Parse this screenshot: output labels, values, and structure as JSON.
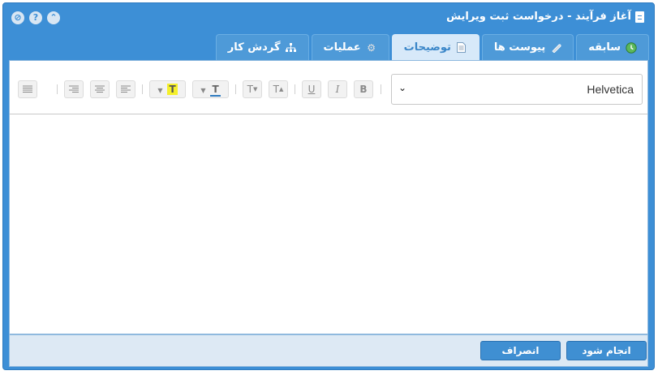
{
  "window": {
    "title": "آغاز فرآیند - درخواست ثبت ویرایش",
    "controls": [
      "collapse",
      "help",
      "close"
    ]
  },
  "tabs": [
    {
      "label": "گردش کار",
      "icon": "sitemap-icon",
      "active": false
    },
    {
      "label": "عملیات",
      "icon": "gear-icon",
      "active": false
    },
    {
      "label": "توضیحات",
      "icon": "document-icon",
      "active": true
    },
    {
      "label": "پیوست ها",
      "icon": "paperclip-icon",
      "active": false
    },
    {
      "label": "سابقه",
      "icon": "history-icon",
      "active": false
    }
  ],
  "editor": {
    "font": "Helvetica",
    "buttons": {
      "bold": "B",
      "italic": "I",
      "underline": "U",
      "superscript": "T",
      "subscript": "T",
      "text_color": "T",
      "highlight": "T"
    },
    "content": ""
  },
  "footer": {
    "submit_label": "انجام شود",
    "cancel_label": "انصراف"
  },
  "colors": {
    "window_blue": "#3d8fd6",
    "active_tab": "#d7e9f9",
    "highlight_yellow": "#f5f02a",
    "text_color_underline": "#2f7bbf"
  }
}
